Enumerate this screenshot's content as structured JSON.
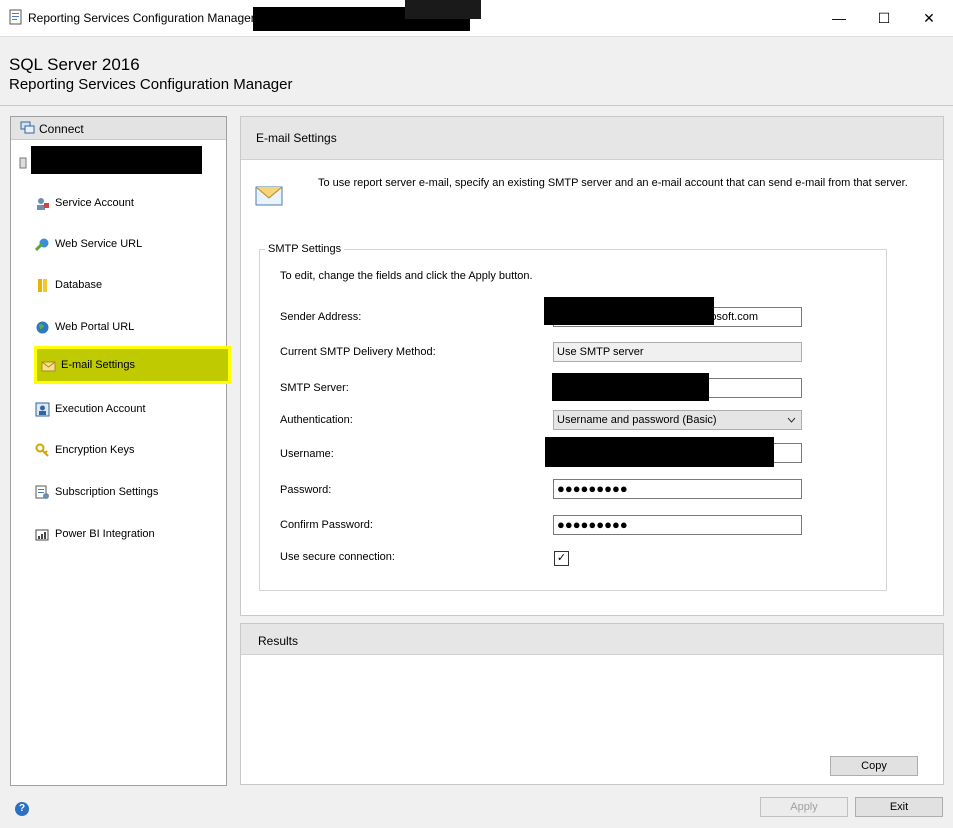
{
  "window": {
    "title": "Reporting Services Configuration Manager",
    "minimize": "—",
    "maximize": "☐",
    "close": "✕"
  },
  "header": {
    "product": "SQL Server 2016",
    "app": "Reporting Services Configuration Manager"
  },
  "nav": {
    "connect_label": "Connect",
    "items": [
      {
        "label": "Service Account",
        "icon": "service-account-icon"
      },
      {
        "label": "Web Service URL",
        "icon": "web-service-icon"
      },
      {
        "label": "Database",
        "icon": "database-icon"
      },
      {
        "label": "Web Portal URL",
        "icon": "globe-icon"
      },
      {
        "label": "E-mail Settings",
        "icon": "email-icon"
      },
      {
        "label": "Execution Account",
        "icon": "execution-account-icon"
      },
      {
        "label": "Encryption Keys",
        "icon": "key-icon"
      },
      {
        "label": "Subscription Settings",
        "icon": "subscription-icon"
      },
      {
        "label": "Power BI Integration",
        "icon": "powerbi-icon"
      }
    ],
    "selected": "E-mail Settings"
  },
  "email": {
    "title": "E-mail Settings",
    "intro": "To use report server e-mail, specify an existing SMTP server and an e-mail account that can send e-mail from that server.",
    "group_title": "SMTP Settings",
    "instruction": "To edit, change the fields and click the Apply button.",
    "sender_label": "Sender Address:",
    "sender_value": "osoft.com",
    "method_label": "Current SMTP Delivery Method:",
    "method_value": "Use SMTP server",
    "server_label": "SMTP Server:",
    "auth_label": "Authentication:",
    "auth_value": "Username and password (Basic)",
    "username_label": "Username:",
    "password_label": "Password:",
    "password_value": "●●●●●●●●●",
    "confirm_label": "Confirm Password:",
    "confirm_value": "●●●●●●●●●",
    "secure_label": "Use secure connection:",
    "secure_checked": "✓"
  },
  "results": {
    "title": "Results",
    "copy_label": "Copy"
  },
  "footer": {
    "help": "?",
    "apply_label": "Apply",
    "exit_label": "Exit"
  }
}
